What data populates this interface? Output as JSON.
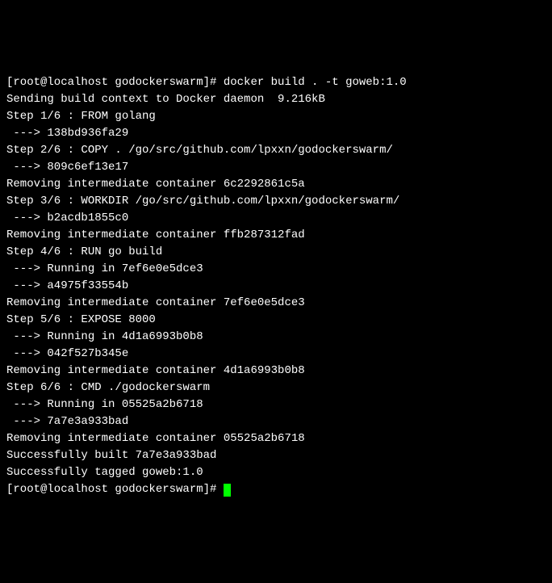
{
  "lines": [
    "[root@localhost godockerswarm]# docker build . -t goweb:1.0",
    "Sending build context to Docker daemon  9.216kB",
    "Step 1/6 : FROM golang",
    " ---> 138bd936fa29",
    "Step 2/6 : COPY . /go/src/github.com/lpxxn/godockerswarm/",
    " ---> 809c6ef13e17",
    "Removing intermediate container 6c2292861c5a",
    "Step 3/6 : WORKDIR /go/src/github.com/lpxxn/godockerswarm/",
    " ---> b2acdb1855c0",
    "Removing intermediate container ffb287312fad",
    "Step 4/6 : RUN go build",
    " ---> Running in 7ef6e0e5dce3",
    " ---> a4975f33554b",
    "Removing intermediate container 7ef6e0e5dce3",
    "Step 5/6 : EXPOSE 8000",
    " ---> Running in 4d1a6993b0b8",
    " ---> 042f527b345e",
    "Removing intermediate container 4d1a6993b0b8",
    "Step 6/6 : CMD ./godockerswarm",
    " ---> Running in 05525a2b6718",
    " ---> 7a7e3a933bad",
    "Removing intermediate container 05525a2b6718",
    "Successfully built 7a7e3a933bad",
    "Successfully tagged goweb:1.0"
  ],
  "prompt": "[root@localhost godockerswarm]# "
}
